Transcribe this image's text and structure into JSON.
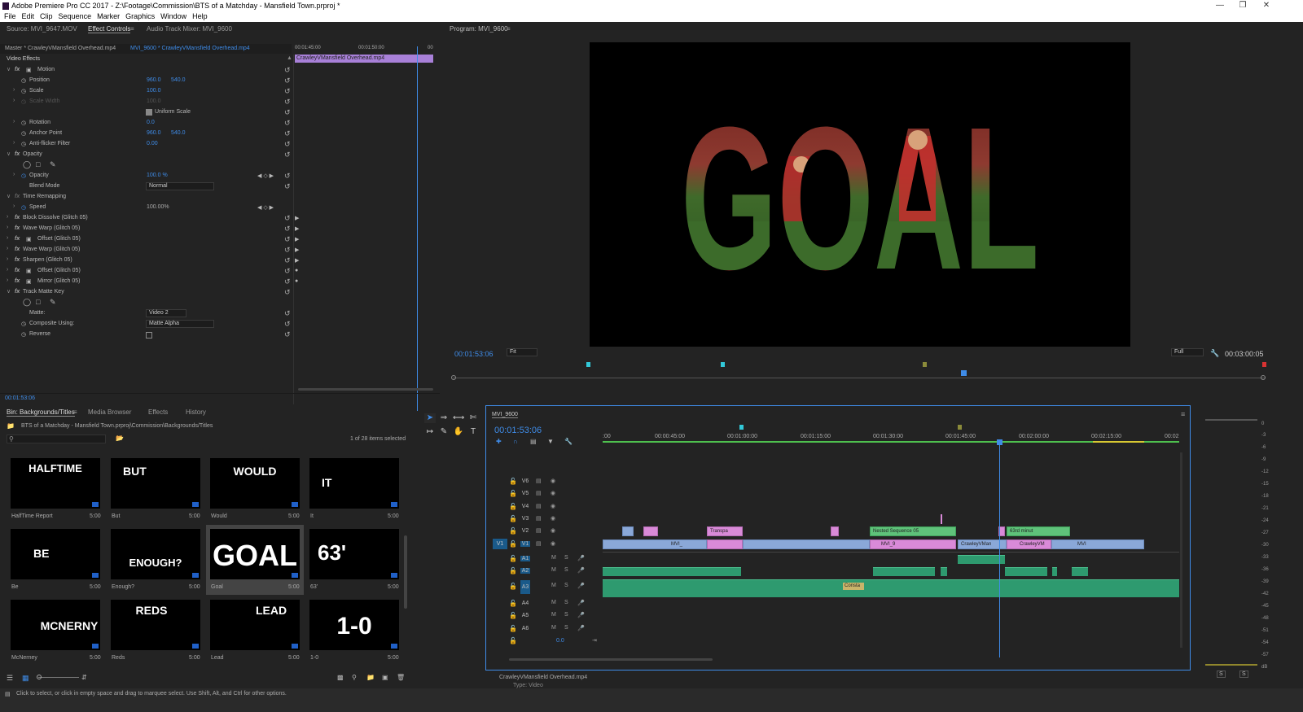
{
  "app": {
    "title": "Adobe Premiere Pro CC 2017 - Z:\\Footage\\Commission\\BTS of a Matchday - Mansfield Town.prproj *",
    "menu": [
      "File",
      "Edit",
      "Clip",
      "Sequence",
      "Marker",
      "Graphics",
      "Window",
      "Help"
    ]
  },
  "effect_controls": {
    "tabs": [
      "Source: MVI_9647.MOV",
      "Effect Controls",
      "Audio Track Mixer: MVI_9600"
    ],
    "source_clip": "Master * CrawleyVMansfield Overhead.mp4",
    "sequence_clip": "MVI_9600 * CrawleyVMansfield Overhead.mp4",
    "mini_timecodes": [
      "00:01:45:00",
      "00:01:50:00",
      "00"
    ],
    "mini_clip": "CrawleyVMansfield Overhead.mp4",
    "section": "Video Effects",
    "motion": "Motion",
    "position_label": "Position",
    "position_x": "960.0",
    "position_y": "540.0",
    "scale_label": "Scale",
    "scale_value": "100.0",
    "scale_width_label": "Scale Width",
    "scale_width_value": "100.0",
    "uniform_scale": "Uniform Scale",
    "rotation_label": "Rotation",
    "rotation_value": "0.0",
    "anchor_label": "Anchor Point",
    "anchor_x": "960.0",
    "anchor_y": "540.0",
    "antiflicker_label": "Anti-flicker Filter",
    "antiflicker_value": "0.00",
    "opacity_group": "Opacity",
    "opacity_label": "Opacity",
    "opacity_value": "100.0 %",
    "blend_label": "Blend Mode",
    "blend_value": "Normal",
    "time_remap": "Time Remapping",
    "speed_label": "Speed",
    "speed_value": "100.00%",
    "effects": [
      "Block Dissolve (Glitch 05)",
      "Wave Warp (Glitch 05)",
      "Offset (Glitch 05)",
      "Wave Warp (Glitch 05)",
      "Sharpen (Glitch 05)",
      "Offset (Glitch 05)",
      "Mirror (Glitch 05)"
    ],
    "track_matte": "Track Matte Key",
    "matte_label": "Matte:",
    "matte_value": "Video 2",
    "composite_label": "Composite Using:",
    "composite_value": "Matte Alpha",
    "reverse_label": "Reverse",
    "timecode": "00:01:53:06"
  },
  "program": {
    "tab": "Program: MVI_9600",
    "overlay_text": "GOAL",
    "timecode": "00:01:53:06",
    "fit": "Fit",
    "quality": "Full",
    "duration": "00:03:00:05"
  },
  "project": {
    "tabs": [
      "Bin: Backgrounds/Titles",
      "Media Browser",
      "Effects",
      "History"
    ],
    "path": "BTS of a Matchday - Mansfield Town.prproj\\Commission\\Backgrounds/Titles",
    "selection": "1 of 28 items selected",
    "items": [
      {
        "thumb": "HALFTIME",
        "name": "HalfTime Report",
        "dur": "5:00"
      },
      {
        "thumb": "BUT",
        "name": "But",
        "dur": "5:00"
      },
      {
        "thumb": "WOULD",
        "name": "Would",
        "dur": "5:00"
      },
      {
        "thumb": "IT",
        "name": "It",
        "dur": "5:00"
      },
      {
        "thumb": "BE",
        "name": "Be",
        "dur": "5:00"
      },
      {
        "thumb": "ENOUGH?",
        "name": "Enough?",
        "dur": "5:00"
      },
      {
        "thumb": "GOAL",
        "name": "Goal",
        "dur": "5:00"
      },
      {
        "thumb": "63'",
        "name": "63'",
        "dur": "5:00"
      },
      {
        "thumb": "MCNERNY",
        "name": "McNerney",
        "dur": "5:00"
      },
      {
        "thumb": "REDS",
        "name": "Reds",
        "dur": "5:00"
      },
      {
        "thumb": "LEAD",
        "name": "Lead",
        "dur": "5:00"
      },
      {
        "thumb": "1-0",
        "name": "1-0",
        "dur": "5:00"
      }
    ]
  },
  "timeline": {
    "tab": "MVI_9600",
    "timecode": "00:01:53:06",
    "ruler": [
      ":00",
      "00:00:45:00",
      "00:01:00:00",
      "00:01:15:00",
      "00:01:30:00",
      "00:01:45:00",
      "00:02:00:00",
      "00:02:15:00",
      "00:02"
    ],
    "video_tracks": [
      "V6",
      "V5",
      "V4",
      "V3",
      "V2",
      "V1"
    ],
    "audio_tracks": [
      "A1",
      "A2",
      "A3",
      "A4",
      "A5",
      "A6"
    ],
    "source_patch": "V1",
    "master_value": "0.0",
    "clips": {
      "transpa": "Transpa",
      "nested": "Nested Sequence 05",
      "minute": "63rd minut",
      "mvi_a": "MVI_",
      "mvi_b": "MVI_9",
      "crawley_a": "CrawleyVMan",
      "crawley_b": "CrawleyVM",
      "mvi_c": "MVI",
      "constant": "Consta"
    },
    "bottom_info": "CrawleyVMansfield Overhead.mp4",
    "bottom_info2": "Type: Video"
  },
  "meters": {
    "scale": [
      "0",
      "-3",
      "-6",
      "-9",
      "-12",
      "-15",
      "-18",
      "-21",
      "-24",
      "-27",
      "-30",
      "-33",
      "-36",
      "-39",
      "-42",
      "-45",
      "-48",
      "-51",
      "-54",
      "-57",
      "dB"
    ],
    "solo": [
      "S",
      "S"
    ]
  },
  "status": "Click to select, or click in empty space and drag to marquee select. Use Shift, Alt, and Ctrl for other options."
}
